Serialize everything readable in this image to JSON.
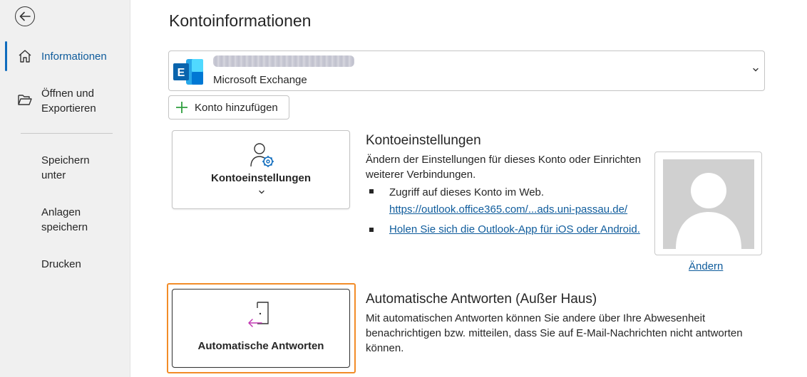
{
  "sidebar": {
    "items": [
      {
        "label": "Informationen",
        "icon": "home-icon",
        "active": true
      },
      {
        "label": "Öffnen und Exportieren",
        "line1": "Öffnen und",
        "line2": "Exportieren",
        "icon": "folder-open-icon"
      },
      {
        "line1": "Speichern",
        "line2": "unter"
      },
      {
        "line1": "Anlagen",
        "line2": "speichern"
      },
      {
        "label": "Drucken"
      }
    ],
    "back_icon": "back-arrow-icon"
  },
  "main": {
    "title": "Kontoinformationen",
    "account": {
      "type": "Microsoft Exchange",
      "icon": "exchange-icon"
    },
    "add_account_label": "Konto hinzufügen",
    "account_settings": {
      "tile_label": "Kontoeinstellungen",
      "heading": "Kontoeinstellungen",
      "desc_line1": "Ändern der Einstellungen für dieses Konto oder Einrichten",
      "desc_line2": "weiterer Verbindungen.",
      "bullet1": "Zugriff auf dieses Konto im Web.",
      "bullet1_link": "https://outlook.office365.com/...ads.uni-passau.de/",
      "bullet2_link": "Holen Sie sich die Outlook-App für iOS oder Android."
    },
    "photo": {
      "change_label": "Ändern"
    },
    "auto_reply": {
      "tile_label": "Automatische Antworten",
      "heading": "Automatische Antworten (Außer Haus)",
      "desc_line1": "Mit automatischen Antworten können Sie andere über Ihre Abwesenheit",
      "desc_line2": "benachrichtigen bzw. mitteilen, dass Sie auf E-Mail-Nachrichten nicht antworten",
      "desc_line3": "können."
    }
  },
  "colors": {
    "accent": "#0f6cbd",
    "link": "#0f5c9c",
    "highlight": "#f28c28",
    "exchange_blue": "#0a64ad",
    "sidebar_bg": "#f0f0f0"
  }
}
